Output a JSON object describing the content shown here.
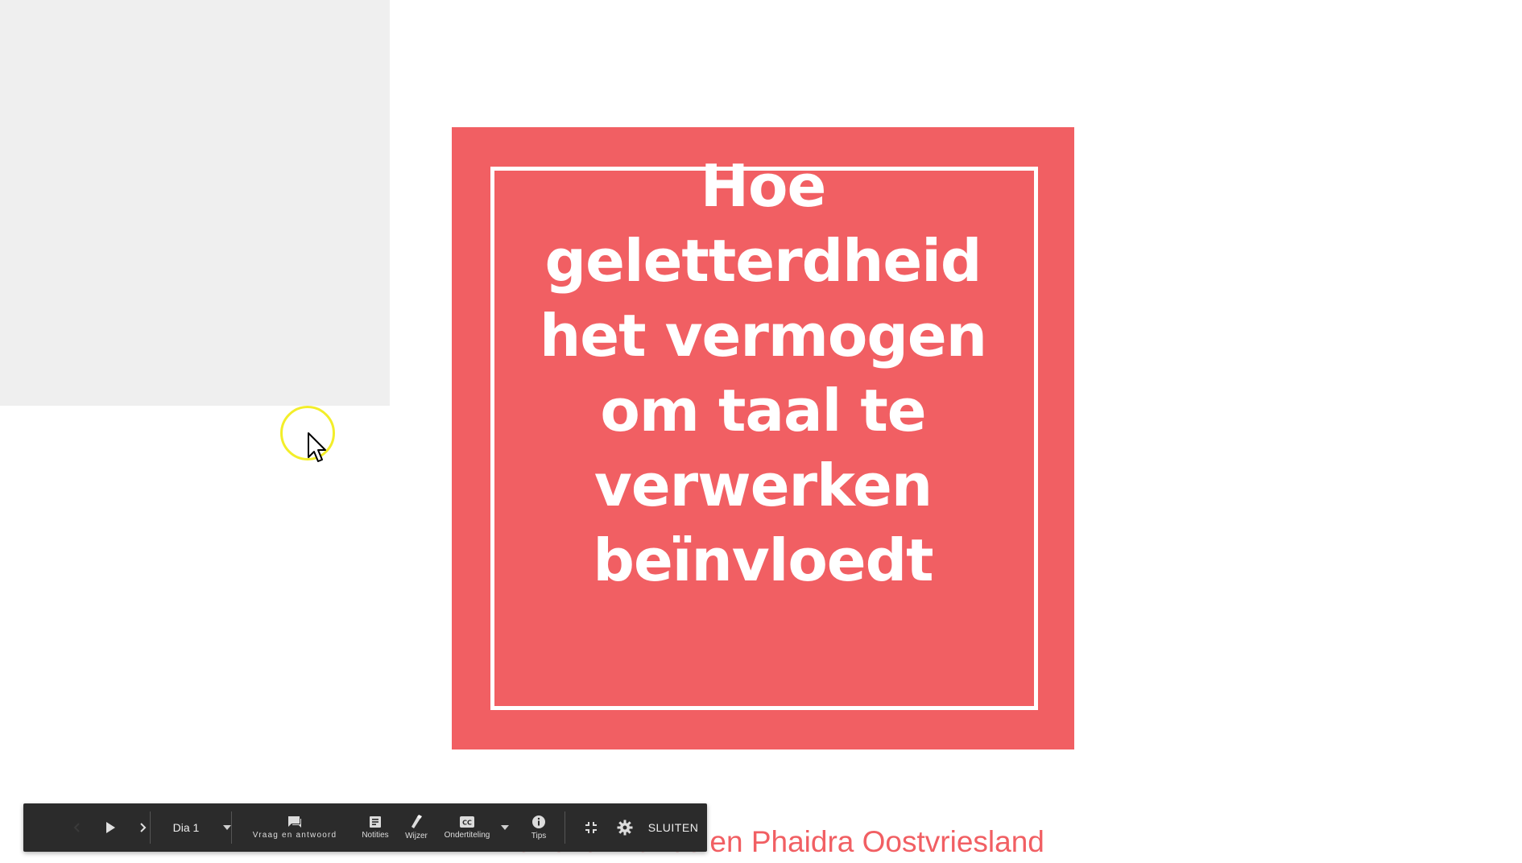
{
  "slide": {
    "title_lines": [
      "Hoe",
      "geletterdheid",
      "het vermogen",
      "om taal te",
      "verwerken",
      "beïnvloedt"
    ],
    "background_color": "#f15f63",
    "frame_color": "#ffffff"
  },
  "author_line": "Marieke Brands en Phaidra Oostvriesland",
  "toolbar": {
    "slide_selector_label": "Dia 1",
    "qa_label": "Vraag en antwoord",
    "notes_label": "Notities",
    "pointer_label": "Wijzer",
    "captions_label": "Ondertiteling",
    "tips_label": "Tips",
    "close_label": "SLUITEN"
  },
  "icons": {
    "previous": "chevron-left-icon",
    "play": "play-icon",
    "next": "chevron-right-icon",
    "slide_dropdown": "caret-down-icon",
    "qa": "chat-bubble-icon",
    "notes": "notes-icon",
    "pointer": "laser-pointer-icon",
    "captions": "closed-captions-icon",
    "captions_dropdown": "caret-down-icon",
    "tips": "info-icon",
    "exit_fullscreen": "exit-fullscreen-icon",
    "settings": "gear-icon"
  },
  "colors": {
    "toolbar_bg": "#2b2b2b",
    "grey_panel": "#efefef",
    "cursor_highlight": "#f3ee2a"
  }
}
